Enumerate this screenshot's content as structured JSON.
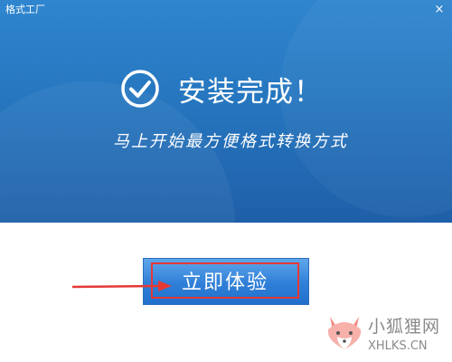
{
  "window": {
    "title": "格式工厂",
    "close_glyph": "×"
  },
  "banner": {
    "headline": "安装完成！",
    "subtitle": "马上开始最方便格式转换方式",
    "check_icon": "check-circle-icon"
  },
  "action": {
    "try_label": "立即体验"
  },
  "annotation": {
    "arrow_color": "#e53935",
    "highlight_color": "#e53935"
  },
  "watermark": {
    "name": "小狐狸网",
    "url": "XHLKS.CN"
  },
  "colors": {
    "banner_top": "#2f86cf",
    "banner_bottom": "#1f5fa8",
    "button_blue": "#2f7fd8",
    "text_white": "#ffffff",
    "watermark_gray": "#8a8a8a"
  }
}
